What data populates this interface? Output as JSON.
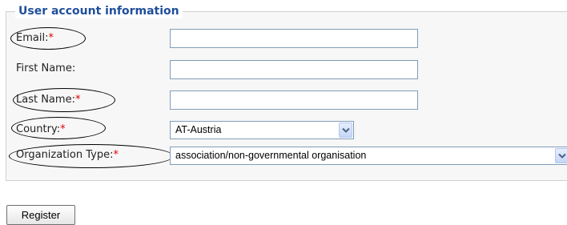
{
  "form": {
    "legend": "User account information",
    "required_marker": "*",
    "fields": {
      "email": {
        "label": "Email:",
        "value": "",
        "required": true
      },
      "first_name": {
        "label": "First Name:",
        "value": "",
        "required": false
      },
      "last_name": {
        "label": "Last Name:",
        "value": "",
        "required": true
      },
      "country": {
        "label": "Country:",
        "selected": "AT-Austria",
        "required": true
      },
      "organization_type": {
        "label": "Organization Type:",
        "selected": "association/non-governmental organisation",
        "required": true
      }
    }
  },
  "actions": {
    "register_label": "Register"
  },
  "colors": {
    "legend": "#1f4e9c",
    "required": "#e00000",
    "input_border": "#7f9db9",
    "fieldset_bg": "#f7f7f7"
  },
  "icons": {
    "dropdown": "chevron-down-icon"
  }
}
